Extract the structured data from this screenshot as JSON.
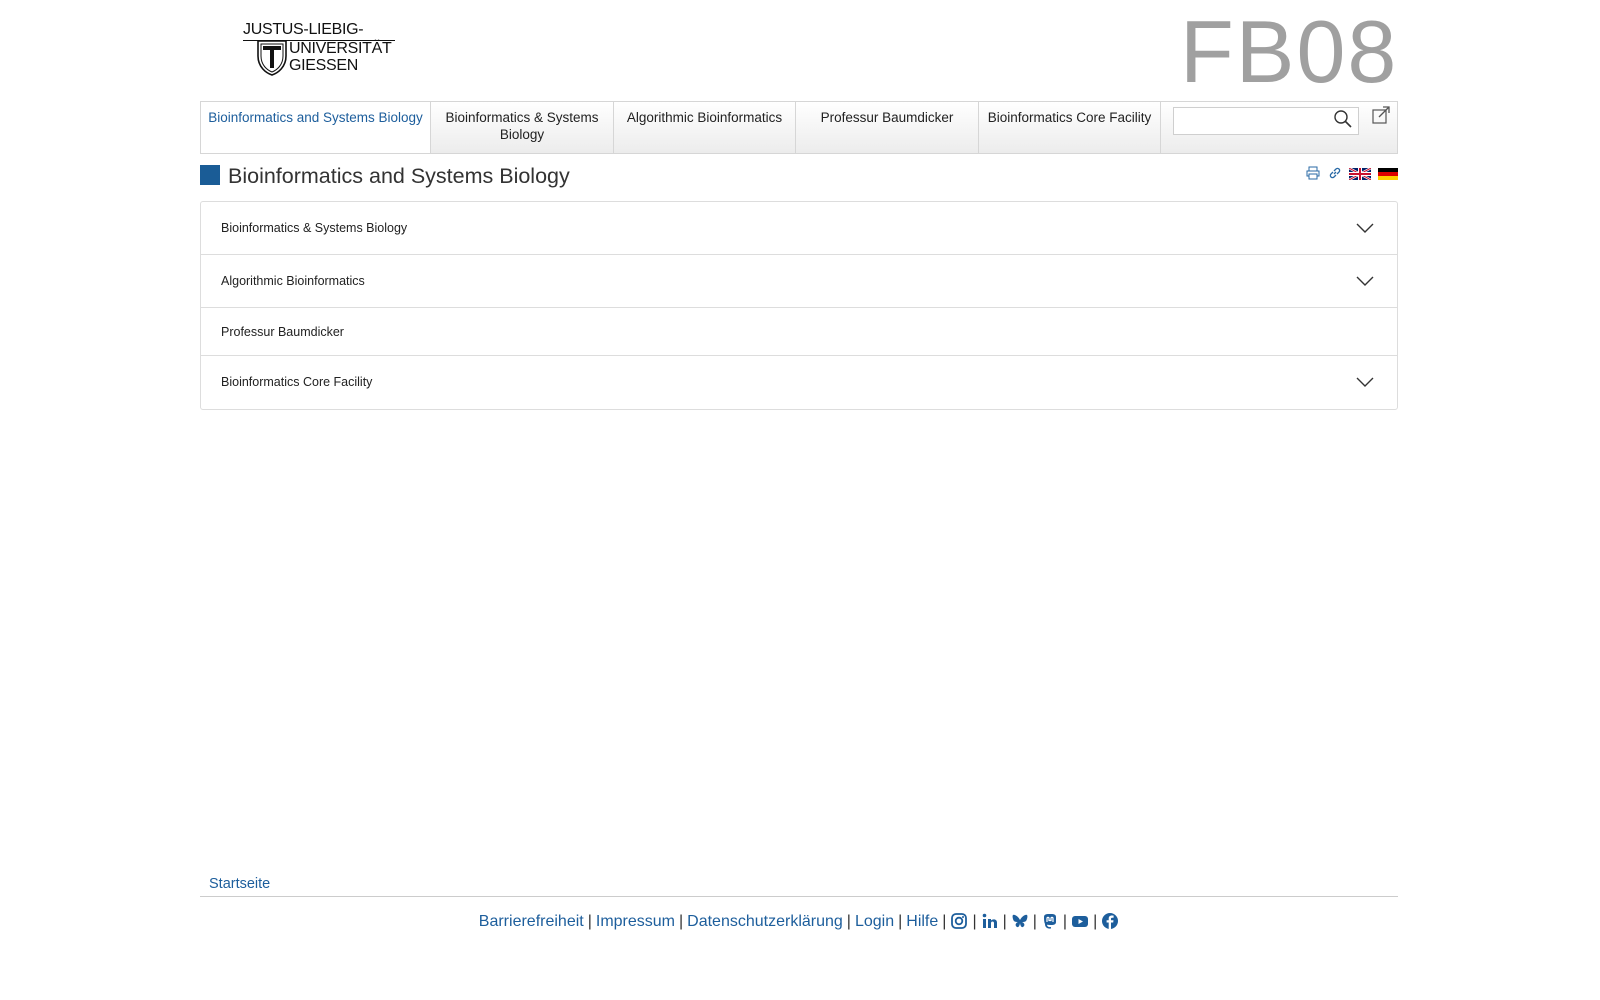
{
  "header": {
    "logo_line1": "JUSTUS-LIEBIG-",
    "logo_line2": "UNIVERSITÄT",
    "logo_line3": "GIESSEN",
    "department": "FB08"
  },
  "nav": {
    "items": [
      {
        "label": "Bioinformatics and Systems Biology",
        "active": true
      },
      {
        "label": "Bioinformatics & Systems Biology",
        "active": false
      },
      {
        "label": "Algorithmic Bioinformatics",
        "active": false
      },
      {
        "label": "Professur Baumdicker",
        "active": false
      },
      {
        "label": "Bioinformatics Core Facility",
        "active": false
      }
    ],
    "search_value": ""
  },
  "page": {
    "title": "Bioinformatics and Systems Biology"
  },
  "icons": {
    "print": "printer-icon",
    "link": "link-icon",
    "english": "flag-uk-icon",
    "german": "flag-de-icon",
    "search": "search-icon",
    "external": "external-link-icon"
  },
  "accordion": [
    {
      "label": "Bioinformatics & Systems Biology",
      "expandable": true
    },
    {
      "label": "Algorithmic Bioinformatics",
      "expandable": true
    },
    {
      "label": "Professur Baumdicker",
      "expandable": false
    },
    {
      "label": "Bioinformatics Core Facility",
      "expandable": true
    }
  ],
  "footer": {
    "breadcrumb": "Startseite",
    "links": [
      "Barrierefreiheit",
      "Impressum",
      "Datenschutzerklärung",
      "Login",
      "Hilfe"
    ],
    "separator": "|",
    "social": [
      "instagram-icon",
      "linkedin-icon",
      "bluesky-icon",
      "mastodon-icon",
      "youtube-icon",
      "facebook-icon"
    ]
  },
  "colors": {
    "accent": "#1a5c96",
    "link": "#1d5e9c",
    "fb_gray": "#a0a0a0"
  }
}
